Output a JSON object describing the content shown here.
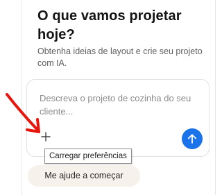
{
  "header": {
    "title": "O que vamos projetar hoje?",
    "subtitle": "Obtenha ideias de layout e crie seu projeto com IA."
  },
  "prompt": {
    "placeholder": "Descreva o projeto de cozinha do seu cliente...",
    "add_icon": "plus-icon",
    "send_icon": "arrow-up-icon"
  },
  "tooltip": {
    "text": "Carregar preferências"
  },
  "actions": {
    "help_label": "Me ajude a começar"
  },
  "annotation": {
    "arrow_color": "#e8150c"
  },
  "colors": {
    "accent": "#1a73e8",
    "chip_bg": "#f6f1ea"
  }
}
